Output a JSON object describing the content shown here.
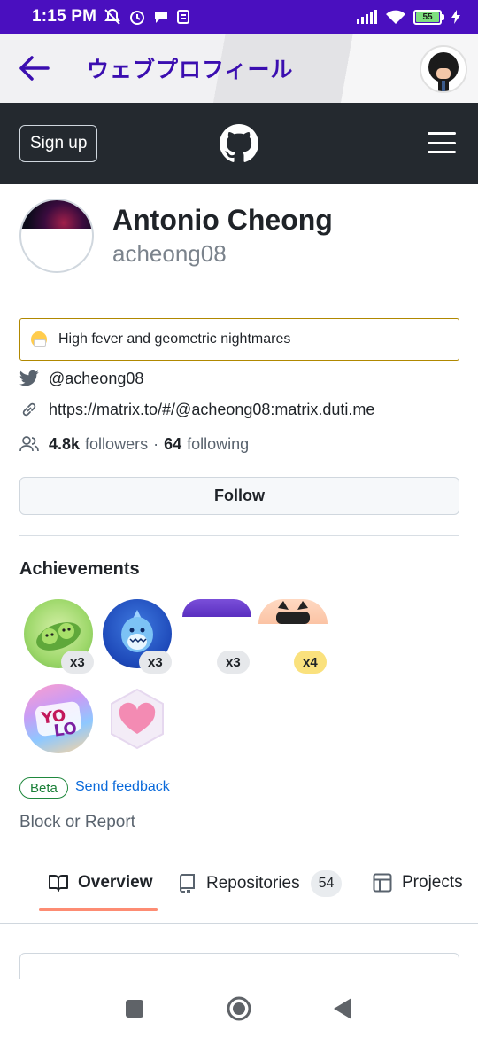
{
  "status_bar": {
    "time": "1:15 PM",
    "battery_level": "55",
    "colors": {
      "background": "#4a0fbf"
    },
    "icons": [
      "notifications-off-icon",
      "alarm-icon",
      "message-icon",
      "sync-icon",
      "signal-icon",
      "wifi-icon",
      "battery-icon",
      "charging-icon"
    ]
  },
  "app_bar": {
    "title": "ウェブプロフィール",
    "back_icon": "arrow-left-icon",
    "avatar_icon": "github-octocat-avatar",
    "colors": {
      "title": "#3b0eb0"
    }
  },
  "gh_header": {
    "signup_label": "Sign up",
    "logo_icon": "github-logo-icon",
    "menu_icon": "hamburger-menu-icon",
    "colors": {
      "background": "#24292f"
    }
  },
  "profile": {
    "name": "Antonio Cheong",
    "login": "acheong08",
    "status": "High fever and geometric nightmares",
    "status_icon": "face-with-mask-emoji",
    "twitter": "@acheong08",
    "website": "https://matrix.to/#/@acheong08:matrix.duti.me",
    "followers_count": "4.8k",
    "followers_label": "followers",
    "separator": "·",
    "following_count": "64",
    "following_label": "following",
    "follow_label": "Follow"
  },
  "achievements": {
    "title": "Achievements",
    "badges": [
      {
        "name": "pair-extraordinaire-badge",
        "count": "x3"
      },
      {
        "name": "starstruck-shark-badge",
        "count": "x3"
      },
      {
        "name": "galaxy-brain-badge",
        "count": "x3"
      },
      {
        "name": "pull-shark-badge",
        "count": "x4"
      },
      {
        "name": "yolo-badge",
        "count": ""
      },
      {
        "name": "public-sponsor-heart-badge",
        "count": ""
      }
    ],
    "beta_label": "Beta",
    "feedback_label": "Send feedback"
  },
  "block_report_label": "Block or Report",
  "tabs": [
    {
      "label": "Overview",
      "icon": "book-icon",
      "count": "",
      "selected": true
    },
    {
      "label": "Repositories",
      "icon": "repo-icon",
      "count": "54",
      "selected": false
    },
    {
      "label": "Projects",
      "icon": "table-icon",
      "count": "",
      "selected": false
    }
  ],
  "nav_bar": {
    "buttons": [
      "recents-square-icon",
      "home-circle-icon",
      "back-triangle-icon"
    ]
  }
}
